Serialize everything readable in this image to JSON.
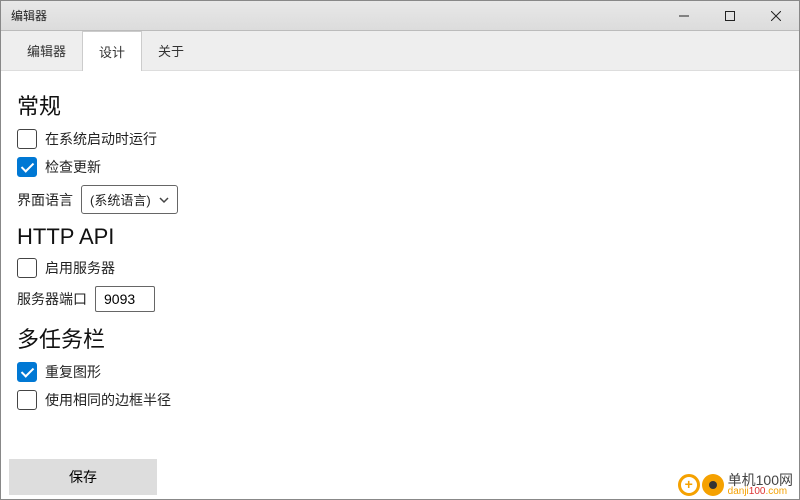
{
  "window": {
    "title": "编辑器"
  },
  "tabs": {
    "editor": "编辑器",
    "design": "设计",
    "about": "关于"
  },
  "sections": {
    "general": {
      "title": "常规",
      "run_on_startup": "在系统启动时运行",
      "check_updates": "检查更新",
      "ui_language_label": "界面语言",
      "ui_language_value": "(系统语言)"
    },
    "http_api": {
      "title": "HTTP API",
      "enable_server": "启用服务器",
      "port_label": "服务器端口",
      "port_value": "9093"
    },
    "multitaskbar": {
      "title": "多任务栏",
      "repeat_graphic": "重复图形",
      "same_radius": "使用相同的边框半径"
    }
  },
  "footer": {
    "save": "保存"
  },
  "watermark": {
    "line1": "单机100网",
    "line2_a": "danji",
    "line2_b": "100",
    "line2_c": ".com"
  }
}
